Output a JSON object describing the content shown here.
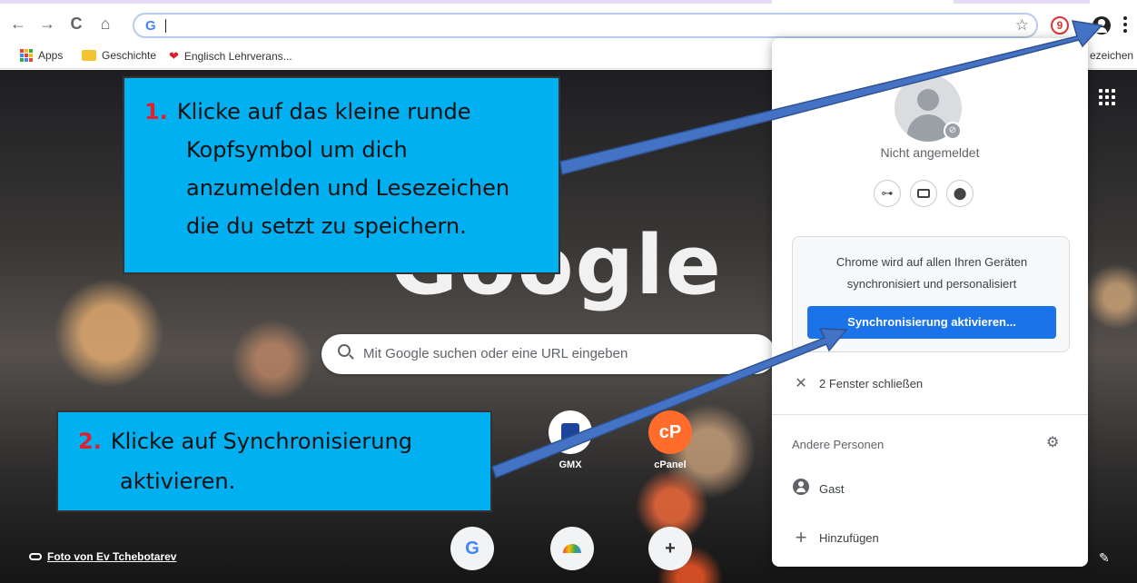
{
  "toolbar": {
    "back": "←",
    "forward": "→",
    "reload": "C",
    "home": "⌂",
    "omnibox_g": "G",
    "star": "☆",
    "ext_label": "9"
  },
  "bookmarks": {
    "apps": "Apps",
    "geschichte": "Geschichte",
    "englisch": "Englisch Lehrverans...",
    "tail": "ezeichen"
  },
  "ntp": {
    "logo": "Google",
    "search_placeholder": "Mit Google suchen oder eine URL eingeben",
    "shortcuts": [
      {
        "label": "GMX",
        "icon": ""
      },
      {
        "label": "cPanel",
        "icon": "cP"
      }
    ],
    "bottom_shortcuts": [
      "G",
      "",
      "+"
    ],
    "photo_credit": "Foto von Ev Tchebotarev"
  },
  "profile_menu": {
    "status": "Nicht angemeldet",
    "sync_text_line1": "Chrome wird auf allen Ihren Geräten",
    "sync_text_line2": "synchronisiert und personalisiert",
    "sync_button": "Synchronisierung aktivieren...",
    "close_windows": "2 Fenster schließen",
    "other_people": "Andere Personen",
    "guest": "Gast",
    "add": "Hinzufügen"
  },
  "annotations": {
    "note1_number": "1.",
    "note1_lines": [
      "Klicke auf das kleine runde",
      "Kopfsymbol um dich",
      "anzumelden und Lesezeichen",
      "die du setzt zu speichern."
    ],
    "note2_number": "2.",
    "note2_lines": [
      "Klicke auf Synchronisierung",
      "aktivieren."
    ]
  },
  "colors": {
    "accent_blue": "#1a73e8",
    "note_bg": "#00b0f0",
    "note_number": "#e0202a",
    "arrow": "#4472c4"
  }
}
